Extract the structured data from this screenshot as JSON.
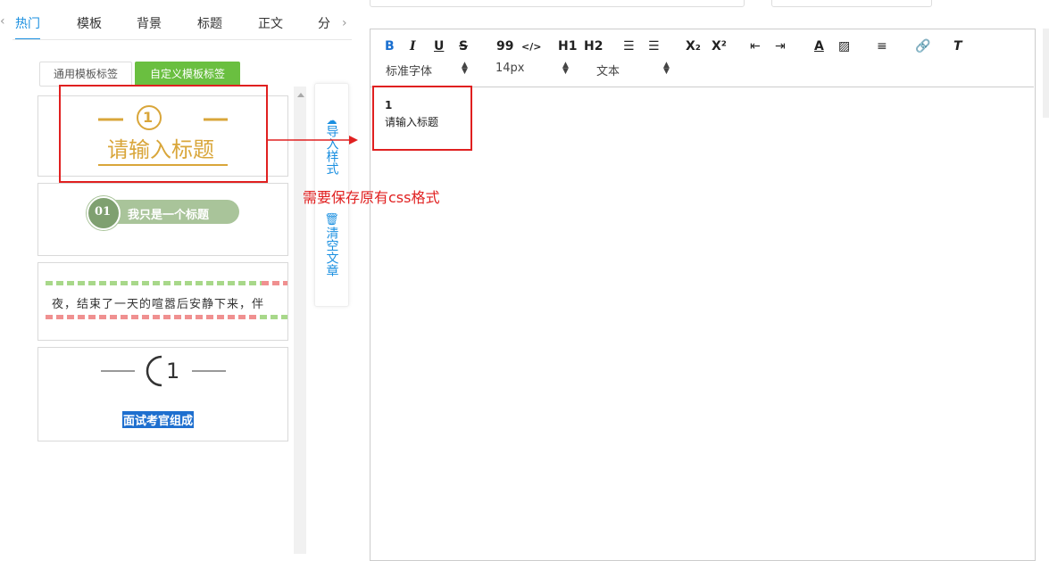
{
  "tabs": [
    "热门",
    "模板",
    "背景",
    "标题",
    "正文",
    "分"
  ],
  "template_tags": {
    "general": "通用模板标签",
    "custom": "自定义模板标签"
  },
  "templates": {
    "t1_number": "1",
    "t1_title": "请输入标题",
    "t2_number": "01",
    "t2_title": "我只是一个标题",
    "t3_text": "夜，结束了一天的喧嚣后安静下来，伴",
    "t4_number": "1",
    "t4_title": "面试考官组成"
  },
  "side_actions": {
    "import": "导入样式",
    "clear": "清空文章"
  },
  "toolbar": {
    "buttons": [
      "B",
      "I",
      "U",
      "S",
      "99",
      "</>",
      "H1",
      "H2",
      "ordered-list",
      "bullet-list",
      "X₂",
      "X²",
      "outdent",
      "indent",
      "font-color",
      "background-color",
      "align",
      "link",
      "clear-format"
    ],
    "font_family": "标准字体",
    "font_size": "14px",
    "block_type": "文本"
  },
  "editor_content": {
    "line1": "1",
    "line2": "请输入标题"
  },
  "annotation": "需要保存原有css格式",
  "colors": {
    "accent": "#1a8fe0",
    "green": "#6abf40",
    "gold": "#d9a63a",
    "red": "#e02020"
  }
}
